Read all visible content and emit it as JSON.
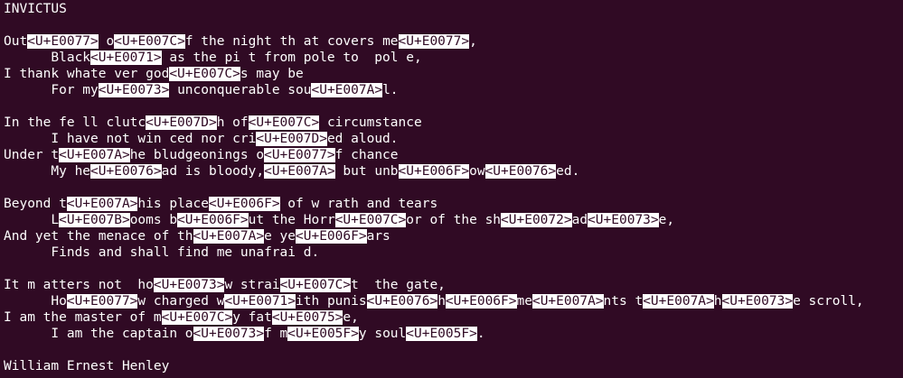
{
  "terminal": {
    "background": "#300a24",
    "foreground": "#ffffff",
    "lines": [
      {
        "segments": [
          {
            "text": "INVICTUS",
            "boxed": false
          }
        ]
      },
      {
        "segments": []
      },
      {
        "segments": [
          {
            "text": "Out",
            "boxed": false
          },
          {
            "text": "<U+E0077>",
            "boxed": true
          },
          {
            "text": " o",
            "boxed": false
          },
          {
            "text": "<U+E007C>",
            "boxed": true
          },
          {
            "text": "f the night th at covers me",
            "boxed": false
          },
          {
            "text": "<U+E0077>",
            "boxed": true
          },
          {
            "text": ",",
            "boxed": false
          }
        ]
      },
      {
        "segments": [
          {
            "text": "      Black",
            "boxed": false
          },
          {
            "text": "<U+E0071>",
            "boxed": true
          },
          {
            "text": " as the pi t from pole to  pol e,",
            "boxed": false
          }
        ]
      },
      {
        "segments": [
          {
            "text": "I thank whate ver god",
            "boxed": false
          },
          {
            "text": "<U+E007C>",
            "boxed": true
          },
          {
            "text": "s may be",
            "boxed": false
          }
        ]
      },
      {
        "segments": [
          {
            "text": "      For my",
            "boxed": false
          },
          {
            "text": "<U+E0073>",
            "boxed": true
          },
          {
            "text": " unconquerable sou",
            "boxed": false
          },
          {
            "text": "<U+E007A>",
            "boxed": true
          },
          {
            "text": "l.",
            "boxed": false
          }
        ]
      },
      {
        "segments": []
      },
      {
        "segments": [
          {
            "text": "In the fe ll clutc",
            "boxed": false
          },
          {
            "text": "<U+E007D>",
            "boxed": true
          },
          {
            "text": "h of",
            "boxed": false
          },
          {
            "text": "<U+E007C>",
            "boxed": true
          },
          {
            "text": " circumstance",
            "boxed": false
          }
        ]
      },
      {
        "segments": [
          {
            "text": "      I have not win ced nor cri",
            "boxed": false
          },
          {
            "text": "<U+E007D>",
            "boxed": true
          },
          {
            "text": "ed aloud.",
            "boxed": false
          }
        ]
      },
      {
        "segments": [
          {
            "text": "Under t",
            "boxed": false
          },
          {
            "text": "<U+E007A>",
            "boxed": true
          },
          {
            "text": "he bludgeonings o",
            "boxed": false
          },
          {
            "text": "<U+E0077>",
            "boxed": true
          },
          {
            "text": "f chance",
            "boxed": false
          }
        ]
      },
      {
        "segments": [
          {
            "text": "      My he",
            "boxed": false
          },
          {
            "text": "<U+E0076>",
            "boxed": true
          },
          {
            "text": "ad is bloody,",
            "boxed": false
          },
          {
            "text": "<U+E007A>",
            "boxed": true
          },
          {
            "text": " but unb",
            "boxed": false
          },
          {
            "text": "<U+E006F>",
            "boxed": true
          },
          {
            "text": "ow",
            "boxed": false
          },
          {
            "text": "<U+E0076>",
            "boxed": true
          },
          {
            "text": "ed.",
            "boxed": false
          }
        ]
      },
      {
        "segments": []
      },
      {
        "segments": [
          {
            "text": "Beyond t",
            "boxed": false
          },
          {
            "text": "<U+E007A>",
            "boxed": true
          },
          {
            "text": "his place",
            "boxed": false
          },
          {
            "text": "<U+E006F>",
            "boxed": true
          },
          {
            "text": " of w rath and tears",
            "boxed": false
          }
        ]
      },
      {
        "segments": [
          {
            "text": "      L",
            "boxed": false
          },
          {
            "text": "<U+E007B>",
            "boxed": true
          },
          {
            "text": "ooms b",
            "boxed": false
          },
          {
            "text": "<U+E006F>",
            "boxed": true
          },
          {
            "text": "ut the Horr",
            "boxed": false
          },
          {
            "text": "<U+E007C>",
            "boxed": true
          },
          {
            "text": "or of the sh",
            "boxed": false
          },
          {
            "text": "<U+E0072>",
            "boxed": true
          },
          {
            "text": "ad",
            "boxed": false
          },
          {
            "text": "<U+E0073>",
            "boxed": true
          },
          {
            "text": "e,",
            "boxed": false
          }
        ]
      },
      {
        "segments": [
          {
            "text": "And yet the menace of th",
            "boxed": false
          },
          {
            "text": "<U+E007A>",
            "boxed": true
          },
          {
            "text": "e ye",
            "boxed": false
          },
          {
            "text": "<U+E006F>",
            "boxed": true
          },
          {
            "text": "ars",
            "boxed": false
          }
        ]
      },
      {
        "segments": [
          {
            "text": "      Finds and shall find me unafrai d.",
            "boxed": false
          }
        ]
      },
      {
        "segments": []
      },
      {
        "segments": [
          {
            "text": "It m atters not  ho",
            "boxed": false
          },
          {
            "text": "<U+E0073>",
            "boxed": true
          },
          {
            "text": "w strai",
            "boxed": false
          },
          {
            "text": "<U+E007C>",
            "boxed": true
          },
          {
            "text": "t  the gate,",
            "boxed": false
          }
        ]
      },
      {
        "segments": [
          {
            "text": "      Ho",
            "boxed": false
          },
          {
            "text": "<U+E0077>",
            "boxed": true
          },
          {
            "text": "w charged w",
            "boxed": false
          },
          {
            "text": "<U+E0071>",
            "boxed": true
          },
          {
            "text": "ith punis",
            "boxed": false
          },
          {
            "text": "<U+E0076>",
            "boxed": true
          },
          {
            "text": "h",
            "boxed": false
          },
          {
            "text": "<U+E006F>",
            "boxed": true
          },
          {
            "text": "me",
            "boxed": false
          },
          {
            "text": "<U+E007A>",
            "boxed": true
          },
          {
            "text": "nts t",
            "boxed": false
          },
          {
            "text": "<U+E007A>",
            "boxed": true
          },
          {
            "text": "h",
            "boxed": false
          },
          {
            "text": "<U+E0073>",
            "boxed": true
          },
          {
            "text": "e scroll,",
            "boxed": false
          }
        ]
      },
      {
        "segments": [
          {
            "text": "I am the master of m",
            "boxed": false
          },
          {
            "text": "<U+E007C>",
            "boxed": true
          },
          {
            "text": "y fat",
            "boxed": false
          },
          {
            "text": "<U+E0075>",
            "boxed": true
          },
          {
            "text": "e,",
            "boxed": false
          }
        ]
      },
      {
        "segments": [
          {
            "text": "      I am the captain o",
            "boxed": false
          },
          {
            "text": "<U+E0073>",
            "boxed": true
          },
          {
            "text": "f m",
            "boxed": false
          },
          {
            "text": "<U+E005F>",
            "boxed": true
          },
          {
            "text": "y soul",
            "boxed": false
          },
          {
            "text": "<U+E005F>",
            "boxed": true
          },
          {
            "text": ".",
            "boxed": false
          }
        ]
      },
      {
        "segments": []
      },
      {
        "segments": [
          {
            "text": "William Ernest Henley",
            "boxed": false
          }
        ]
      }
    ]
  }
}
